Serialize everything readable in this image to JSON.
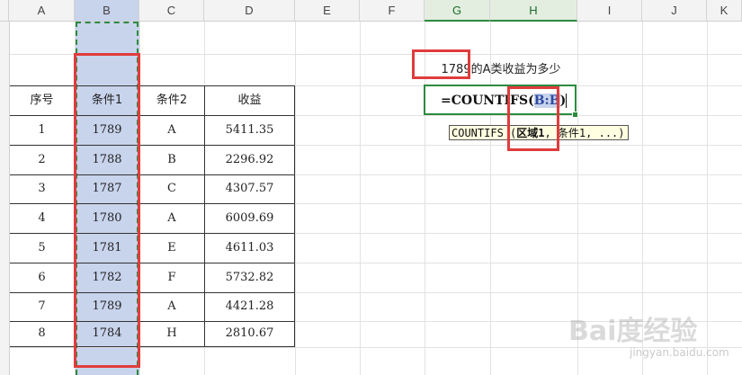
{
  "columns": [
    "A",
    "B",
    "C",
    "D",
    "E",
    "F",
    "G",
    "H",
    "I",
    "J",
    "K"
  ],
  "table": {
    "headers": [
      "序号",
      "条件1",
      "条件2",
      "收益"
    ],
    "rows": [
      [
        "1",
        "1789",
        "A",
        "5411.35"
      ],
      [
        "2",
        "1788",
        "B",
        "2296.92"
      ],
      [
        "3",
        "1787",
        "C",
        "4307.57"
      ],
      [
        "4",
        "1780",
        "A",
        "6009.69"
      ],
      [
        "5",
        "1781",
        "E",
        "4611.03"
      ],
      [
        "6",
        "1782",
        "F",
        "5732.82"
      ],
      [
        "7",
        "1789",
        "A",
        "4421.28"
      ],
      [
        "8",
        "1784",
        "H",
        "2810.67"
      ]
    ]
  },
  "question": "1789的A类收益为多少",
  "formula": {
    "prefix": "=COUNTIFS(",
    "ref": "B:B",
    "suffix": ")"
  },
  "tooltip": {
    "fn": "COUNTIFS",
    "open": " (",
    "arg1": "区域1",
    "rest": ", 条件1, ...)"
  },
  "watermark": {
    "brand": "Bai度经验",
    "url": "jingyan.baidu.com"
  },
  "colors": {
    "selection": "#c8d3ec",
    "highlight_red": "#e03c3c",
    "active_green": "#2d8a3f"
  }
}
